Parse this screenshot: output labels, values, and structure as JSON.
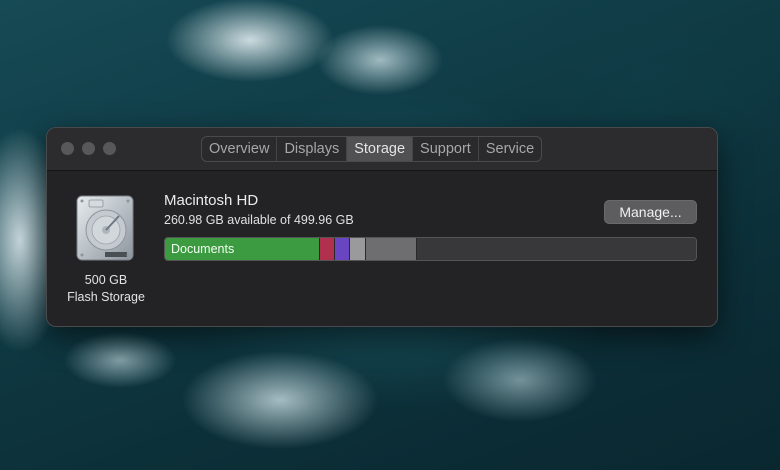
{
  "window": {
    "tabs": [
      {
        "label": "Overview",
        "active": false
      },
      {
        "label": "Displays",
        "active": false
      },
      {
        "label": "Storage",
        "active": true
      },
      {
        "label": "Support",
        "active": false
      },
      {
        "label": "Service",
        "active": false
      }
    ]
  },
  "disk": {
    "icon": "hard-drive-icon",
    "capacity_label": "500 GB",
    "type_label": "Flash Storage",
    "name": "Macintosh HD",
    "available_text": "260.98 GB available of 499.96 GB",
    "manage_label": "Manage..."
  },
  "storage_bar": {
    "segments": [
      {
        "name": "documents",
        "label": "Documents",
        "fraction": 0.292,
        "color": "#3c9a40"
      },
      {
        "name": "red",
        "label": "",
        "fraction": 0.029,
        "color": "#b0304d"
      },
      {
        "name": "purple",
        "label": "",
        "fraction": 0.027,
        "color": "#6a45c2"
      },
      {
        "name": "light-gray",
        "label": "",
        "fraction": 0.03,
        "color": "#9a9a9d"
      },
      {
        "name": "gray",
        "label": "",
        "fraction": 0.097,
        "color": "#6e6e71"
      }
    ],
    "free_color": "#38383b"
  }
}
